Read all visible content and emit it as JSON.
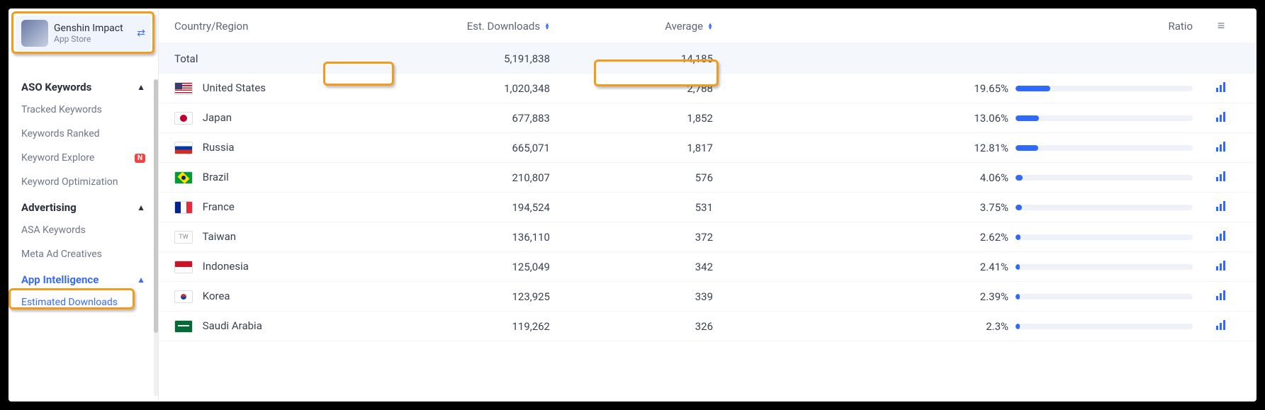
{
  "app": {
    "name": "Genshin Impact",
    "store": "App Store"
  },
  "sidebar": {
    "sections": [
      {
        "title": "ASO Keywords",
        "items": [
          {
            "label": "Tracked Keywords",
            "badge": ""
          },
          {
            "label": "Keywords Ranked",
            "badge": ""
          },
          {
            "label": "Keyword Explore",
            "badge": "N"
          },
          {
            "label": "Keyword Optimization",
            "badge": ""
          }
        ]
      },
      {
        "title": "Advertising",
        "items": [
          {
            "label": "ASA Keywords",
            "badge": ""
          },
          {
            "label": "Meta Ad Creatives",
            "badge": ""
          }
        ]
      },
      {
        "title": "App Intelligence",
        "items": [
          {
            "label": "Estimated Downloads",
            "badge": ""
          }
        ]
      }
    ]
  },
  "table": {
    "headers": {
      "country": "Country/Region",
      "downloads": "Est. Downloads",
      "average": "Average",
      "ratio": "Ratio"
    },
    "total": {
      "label": "Total",
      "downloads": "5,191,838",
      "average": "14,185"
    },
    "rows": [
      {
        "country": "United States",
        "flag": "us",
        "downloads": "1,020,348",
        "average": "2,788",
        "ratio": "19.65%",
        "ratio_val": 19.65
      },
      {
        "country": "Japan",
        "flag": "jp",
        "downloads": "677,883",
        "average": "1,852",
        "ratio": "13.06%",
        "ratio_val": 13.06
      },
      {
        "country": "Russia",
        "flag": "ru",
        "downloads": "665,071",
        "average": "1,817",
        "ratio": "12.81%",
        "ratio_val": 12.81
      },
      {
        "country": "Brazil",
        "flag": "br",
        "downloads": "210,807",
        "average": "576",
        "ratio": "4.06%",
        "ratio_val": 4.06
      },
      {
        "country": "France",
        "flag": "fr",
        "downloads": "194,524",
        "average": "531",
        "ratio": "3.75%",
        "ratio_val": 3.75
      },
      {
        "country": "Taiwan",
        "flag": "tw",
        "downloads": "136,110",
        "average": "372",
        "ratio": "2.62%",
        "ratio_val": 2.62
      },
      {
        "country": "Indonesia",
        "flag": "id",
        "downloads": "125,049",
        "average": "342",
        "ratio": "2.41%",
        "ratio_val": 2.41
      },
      {
        "country": "Korea",
        "flag": "kr",
        "downloads": "123,925",
        "average": "339",
        "ratio": "2.39%",
        "ratio_val": 2.39
      },
      {
        "country": "Saudi Arabia",
        "flag": "sa",
        "downloads": "119,262",
        "average": "326",
        "ratio": "2.3%",
        "ratio_val": 2.3
      }
    ]
  }
}
